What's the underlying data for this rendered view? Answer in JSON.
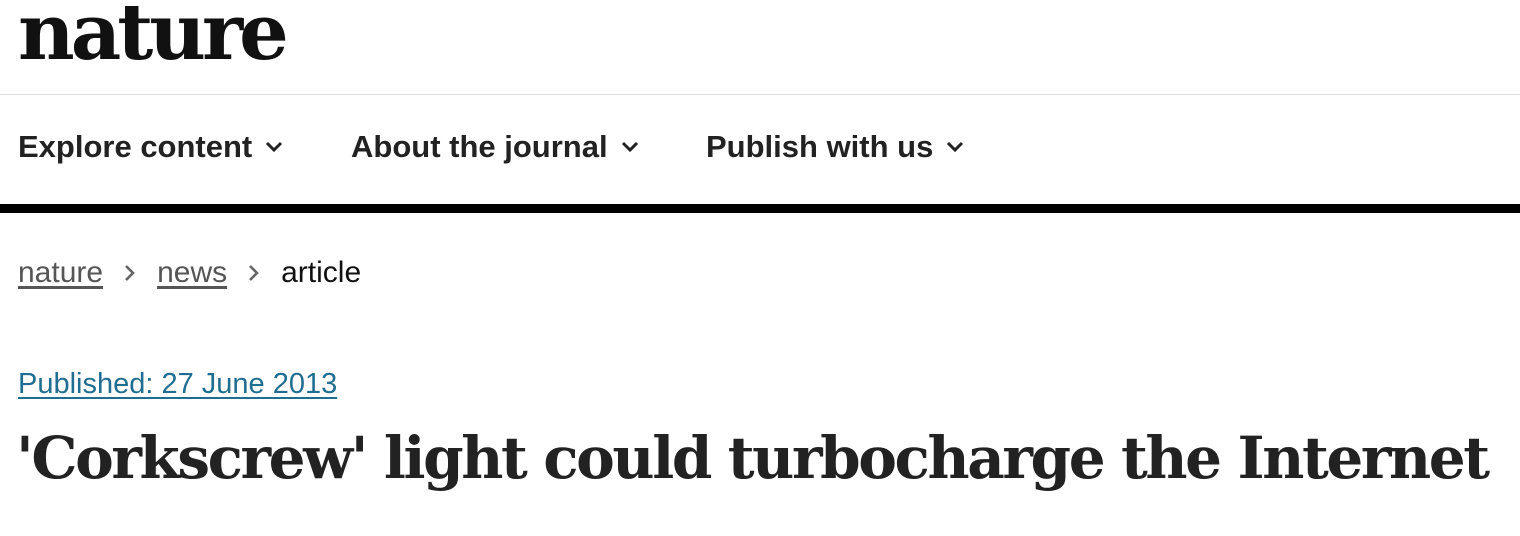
{
  "site": {
    "logo_text": "nature"
  },
  "nav": {
    "items": [
      {
        "label": "Explore content"
      },
      {
        "label": "About the journal"
      },
      {
        "label": "Publish with us"
      }
    ]
  },
  "breadcrumb": {
    "items": [
      {
        "label": "nature"
      },
      {
        "label": "news"
      }
    ],
    "current": "article",
    "separator_icon": "chevron-right-icon"
  },
  "article": {
    "published": "Published: 27 June 2013",
    "title": "'Corkscrew' light could turbocharge the Internet"
  },
  "colors": {
    "text": "#222222",
    "link_blue": "#1f6e91",
    "breadcrumb_link": "#555555",
    "rule": "#000000"
  }
}
